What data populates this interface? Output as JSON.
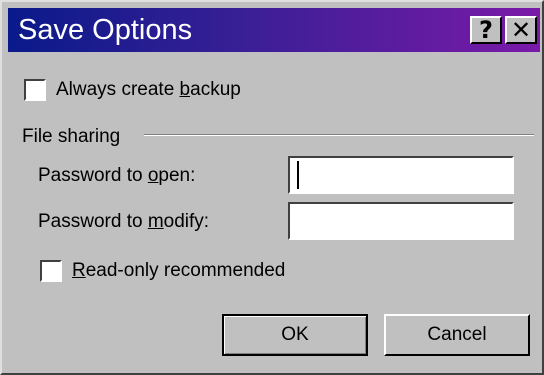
{
  "window": {
    "title": "Save Options",
    "help_glyph": "?",
    "close_glyph": "✕"
  },
  "options": {
    "always_backup": {
      "pre": "Always create ",
      "key": "b",
      "post": "ackup",
      "checked": false
    }
  },
  "file_sharing": {
    "group_label": "File sharing",
    "password_open": {
      "pre": "Password to ",
      "key": "o",
      "post": "pen:",
      "value": ""
    },
    "password_modify": {
      "pre": "Password to ",
      "key": "m",
      "post": "odify:",
      "value": ""
    },
    "read_only": {
      "pre": "",
      "key": "R",
      "post": "ead-only recommended",
      "checked": false
    }
  },
  "buttons": {
    "ok": "OK",
    "cancel": "Cancel"
  },
  "colors": {
    "title_gradient_start": "#0a1a8a",
    "title_gradient_end": "#7a1aa8",
    "dialog_face": "#c0c0c0"
  }
}
